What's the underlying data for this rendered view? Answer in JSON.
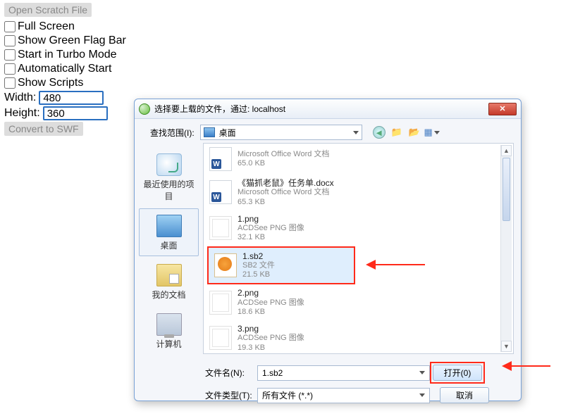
{
  "app": {
    "open_scratch_btn": "Open Scratch File",
    "options": [
      "Full Screen",
      "Show Green Flag Bar",
      "Start in Turbo Mode",
      "Automatically Start",
      "Show Scripts"
    ],
    "width_label": "Width:",
    "width_value": "480",
    "height_label": "Height:",
    "height_value": "360",
    "convert_btn": "Convert to SWF"
  },
  "dialog": {
    "title": "选择要上载的文件，通过: localhost",
    "lookin_label": "查找范围(I):",
    "lookin_value": "桌面",
    "sidebar": {
      "recent": "最近使用的项目",
      "desktop": "桌面",
      "docs": "我的文档",
      "pc": "计算机"
    },
    "files": [
      {
        "name": "",
        "meta1": "Microsoft Office Word 文档",
        "meta2": "65.0 KB",
        "type": "word"
      },
      {
        "name": "《猫抓老鼠》任务单.docx",
        "meta1": "Microsoft Office Word 文档",
        "meta2": "65.3 KB",
        "type": "word"
      },
      {
        "name": "1.png",
        "meta1": "ACDSee PNG 图像",
        "meta2": "32.1 KB",
        "type": "png"
      },
      {
        "name": "1.sb2",
        "meta1": "SB2 文件",
        "meta2": "21.5 KB",
        "type": "sb2",
        "selected": true
      },
      {
        "name": "2.png",
        "meta1": "ACDSee PNG 图像",
        "meta2": "18.6 KB",
        "type": "png"
      },
      {
        "name": "3.png",
        "meta1": "ACDSee PNG 图像",
        "meta2": "19.3 KB",
        "type": "png"
      }
    ],
    "filename_label": "文件名(N):",
    "filename_value": "1.sb2",
    "filetype_label": "文件类型(T):",
    "filetype_value": "所有文件 (*.*)",
    "open_btn": "打开(0)",
    "cancel_btn": "取消"
  }
}
